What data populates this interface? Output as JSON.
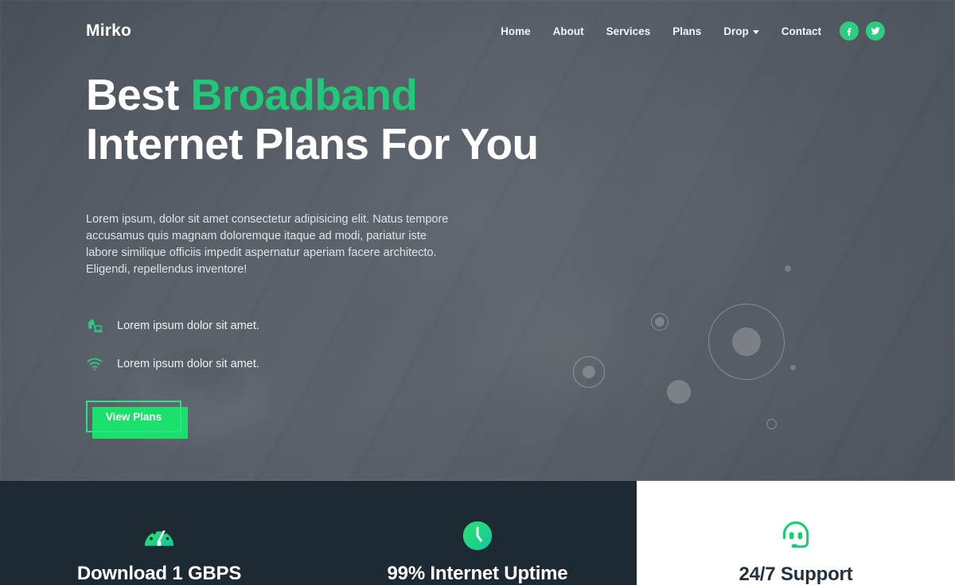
{
  "brand": {
    "name": "Mirko"
  },
  "nav": {
    "items": [
      {
        "label": "Home",
        "has_caret": false
      },
      {
        "label": "About",
        "has_caret": false
      },
      {
        "label": "Services",
        "has_caret": false
      },
      {
        "label": "Plans",
        "has_caret": false
      },
      {
        "label": "Drop",
        "has_caret": true
      },
      {
        "label": "Contact",
        "has_caret": false
      }
    ],
    "social": [
      {
        "name": "facebook-icon"
      },
      {
        "name": "twitter-icon"
      }
    ]
  },
  "hero": {
    "title_line1_plain": "Best ",
    "title_line1_accent": "Broadband",
    "title_line2": "Internet Plans For You",
    "description": "Lorem ipsum, dolor sit amet consectetur adipisicing elit. Natus tempore accusamus quis magnam doloremque itaque ad modi, pariatur iste labore similique officiis impedit aspernatur aperiam facere architecto. Eligendi, repellendus inventore!",
    "features": [
      {
        "icon": "home-network-icon",
        "text": "Lorem ipsum dolor sit amet."
      },
      {
        "icon": "wifi-icon",
        "text": "Lorem ipsum dolor sit amet."
      }
    ],
    "cta": {
      "label": "View Plans"
    }
  },
  "feature_strip": [
    {
      "icon": "speedometer-icon",
      "label": "Download 1 GBPS",
      "theme": "dark"
    },
    {
      "icon": "clock-icon",
      "label": "99% Internet Uptime",
      "theme": "dark"
    },
    {
      "icon": "headset-icon",
      "label": "24/7 Support",
      "theme": "light"
    }
  ],
  "colors": {
    "accent_green": "#20c97a",
    "bright_green": "#18e06a",
    "social_green": "#2ecc82",
    "dark_panel": "#1e2a33",
    "white": "#ffffff"
  }
}
